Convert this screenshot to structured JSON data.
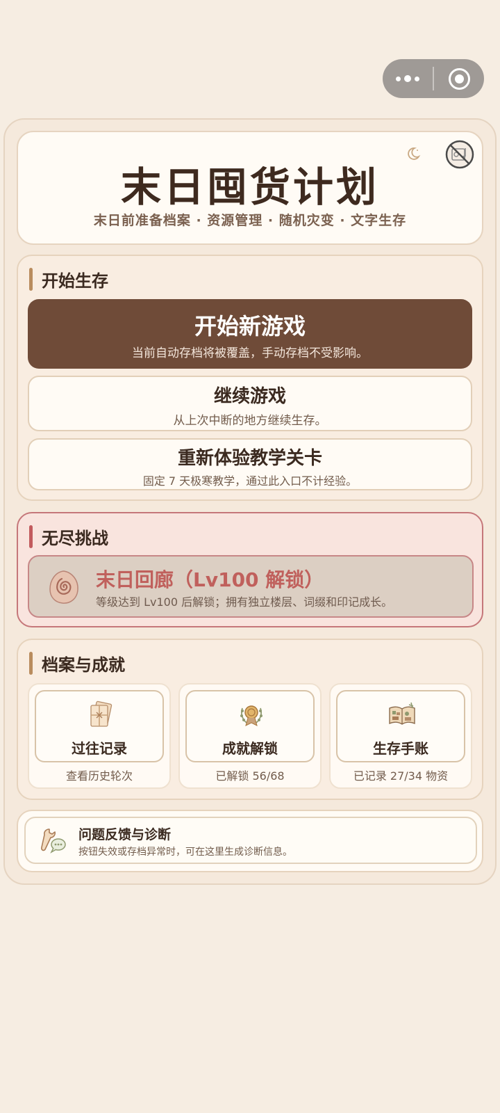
{
  "header": {
    "title": "末日囤货计划",
    "subtitle": "末日前准备档案 · 资源管理 · 随机灾变 · 文字生存"
  },
  "start_section": {
    "heading": "开始生存",
    "new_game": {
      "label": "开始新游戏",
      "desc": "当前自动存档将被覆盖，手动存档不受影响。"
    },
    "continue_game": {
      "label": "继续游戏",
      "desc": "从上次中断的地方继续生存。"
    },
    "tutorial": {
      "label": "重新体验教学关卡",
      "desc": "固定 7 天极寒教学，通过此入口不计经验。"
    }
  },
  "endless_section": {
    "heading": "无尽挑战",
    "corridor": {
      "label": "末日回廊（Lv100 解锁）",
      "desc": "等级达到 Lv100 后解锁；拥有独立楼层、词缀和印记成长。"
    }
  },
  "archive_section": {
    "heading": "档案与成就",
    "cards": [
      {
        "label": "过往记录",
        "sub": "查看历史轮次",
        "icon": "letters-icon"
      },
      {
        "label": "成就解锁",
        "sub": "已解锁 56/68",
        "icon": "medal-icon"
      },
      {
        "label": "生存手账",
        "sub": "已记录 27/34 物资",
        "icon": "journal-icon"
      }
    ]
  },
  "feedback": {
    "label": "问题反馈与诊断",
    "desc": "按钮失效或存档异常时，可在这里生成诊断信息。"
  },
  "colors": {
    "background": "#f6ede2",
    "primary_button": "#6f4b38",
    "endless_accent": "#c0605c",
    "section_bar": "#b98c5e"
  }
}
